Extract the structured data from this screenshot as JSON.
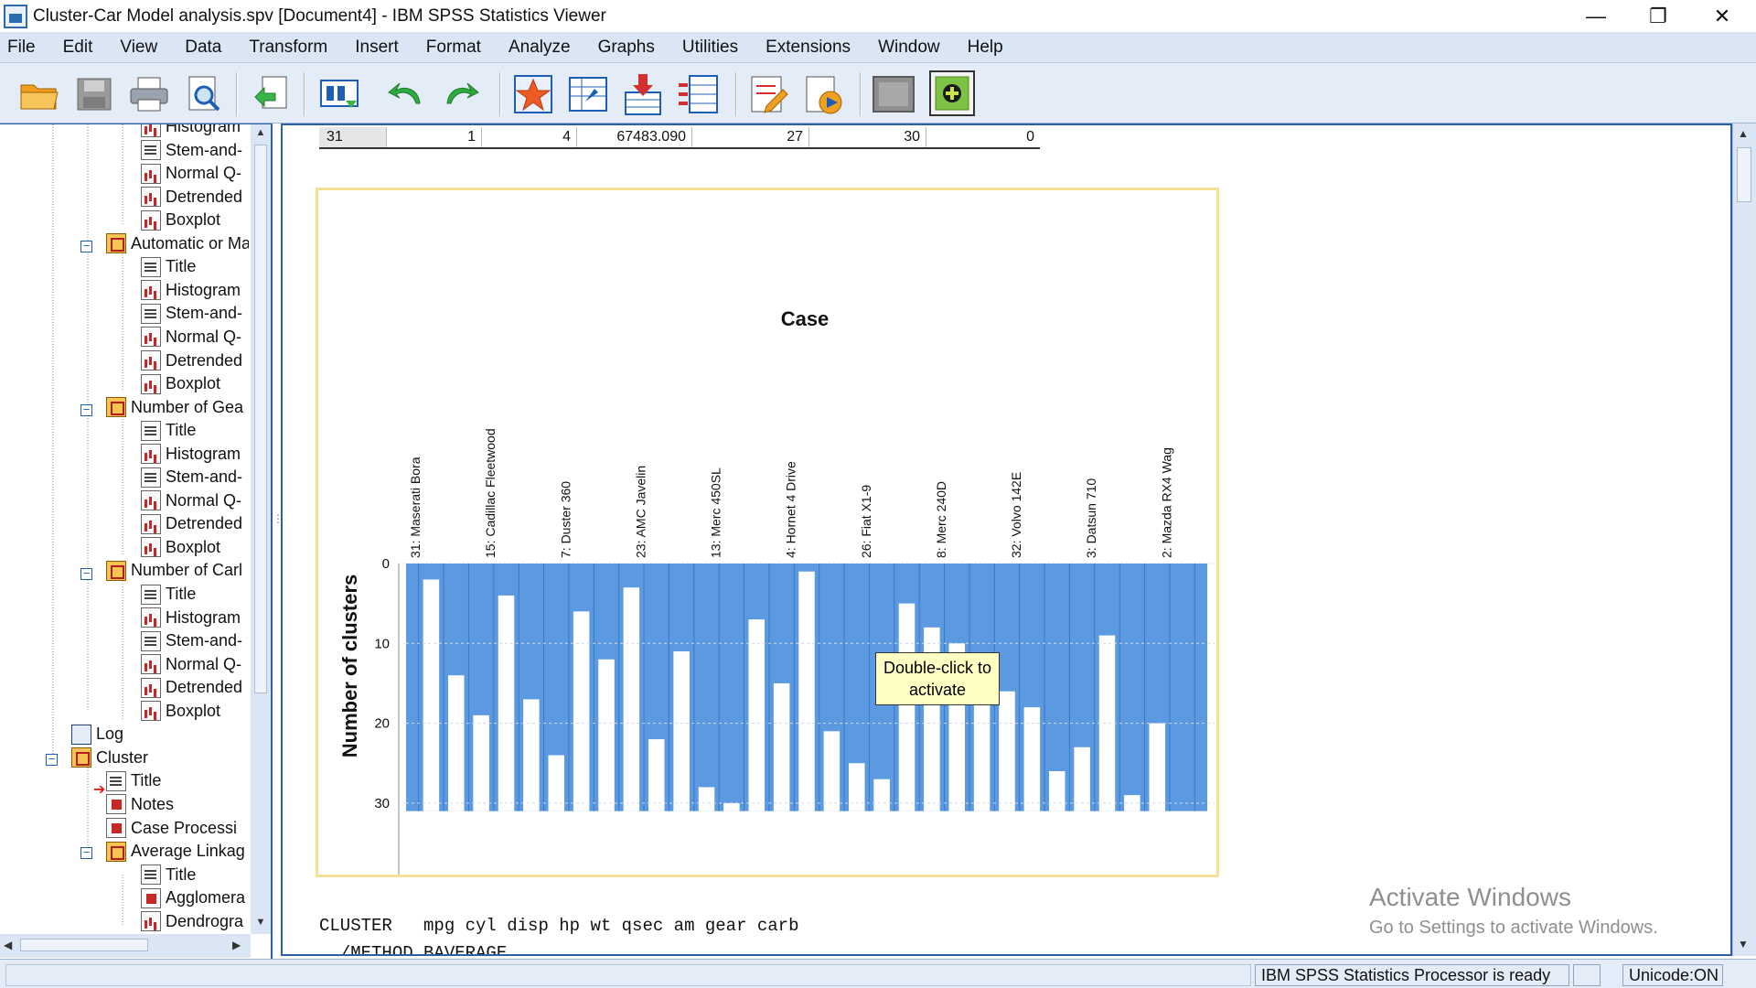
{
  "window": {
    "title": "Cluster-Car Model analysis.spv [Document4] - IBM SPSS Statistics Viewer",
    "minimize": "—",
    "restore": "❐",
    "close": "✕"
  },
  "menu": [
    "File",
    "Edit",
    "View",
    "Data",
    "Transform",
    "Insert",
    "Format",
    "Analyze",
    "Graphs",
    "Utilities",
    "Extensions",
    "Window",
    "Help"
  ],
  "toolbar": [
    "open-folder-icon",
    "save-icon",
    "print-icon",
    "print-preview-icon",
    "export-icon",
    "goto-data-icon",
    "undo-icon",
    "redo-icon",
    "designate-window-icon",
    "goto-case-icon",
    "insert-cases-icon",
    "select-variables-icon",
    "edit-output-icon",
    "run-script-icon",
    "activate-icon",
    "add-icon"
  ],
  "nav_tree": [
    {
      "label": "Histogram",
      "icon": "chart"
    },
    {
      "label": "Stem-and-",
      "icon": "text"
    },
    {
      "label": "Normal Q-",
      "icon": "chart"
    },
    {
      "label": "Detrended",
      "icon": "chart"
    },
    {
      "label": "Boxplot",
      "icon": "chart"
    },
    {
      "label": "Automatic or Ma",
      "icon": "book"
    },
    {
      "label": "Title",
      "icon": "text"
    },
    {
      "label": "Histogram",
      "icon": "chart"
    },
    {
      "label": "Stem-and-",
      "icon": "text"
    },
    {
      "label": "Normal Q-",
      "icon": "chart"
    },
    {
      "label": "Detrended",
      "icon": "chart"
    },
    {
      "label": "Boxplot",
      "icon": "chart"
    },
    {
      "label": "Number of Gea",
      "icon": "book"
    },
    {
      "label": "Title",
      "icon": "text"
    },
    {
      "label": "Histogram",
      "icon": "chart"
    },
    {
      "label": "Stem-and-",
      "icon": "text"
    },
    {
      "label": "Normal Q-",
      "icon": "chart"
    },
    {
      "label": "Detrended",
      "icon": "chart"
    },
    {
      "label": "Boxplot",
      "icon": "chart"
    },
    {
      "label": "Number of Carl",
      "icon": "book"
    },
    {
      "label": "Title",
      "icon": "text"
    },
    {
      "label": "Histogram",
      "icon": "chart"
    },
    {
      "label": "Stem-and-",
      "icon": "text"
    },
    {
      "label": "Normal Q-",
      "icon": "chart"
    },
    {
      "label": "Detrended",
      "icon": "chart"
    },
    {
      "label": "Boxplot",
      "icon": "chart"
    },
    {
      "label": "Log",
      "icon": "log"
    },
    {
      "label": "Cluster",
      "icon": "book"
    },
    {
      "label": "Title",
      "icon": "text"
    },
    {
      "label": "Notes",
      "icon": "table"
    },
    {
      "label": "Case Processi",
      "icon": "table"
    },
    {
      "label": "Average Linkag",
      "icon": "book"
    },
    {
      "label": "Title",
      "icon": "text"
    },
    {
      "label": "Agglomera",
      "icon": "table"
    },
    {
      "label": "Dendrogra",
      "icon": "chart"
    }
  ],
  "table_row": [
    "31",
    "1",
    "4",
    "67483.090",
    "27",
    "30",
    "0"
  ],
  "tooltip": "Double-click to activate",
  "syntax_line1": "CLUSTER   mpg cyl disp hp wt qsec am gear carb",
  "syntax_line2": "  /METHOD BAVERAGE",
  "watermark": {
    "line1": "Activate Windows",
    "line2": "Go to Settings to activate Windows."
  },
  "status": {
    "processor": "IBM SPSS Statistics Processor is ready",
    "unicode": "Unicode:ON"
  },
  "colors": {
    "bar": "#5b9ae0",
    "accent": "#2d5fa8"
  },
  "chart_data": {
    "type": "bar",
    "title": "Case",
    "ylabel": "Number of clusters",
    "ylim": [
      0,
      40
    ],
    "yticks": [
      0,
      10,
      20,
      30,
      40
    ],
    "y_inverted": true,
    "categories_shown": [
      "31: Maserati Bora",
      "15: Cadillac Fleetwood",
      "7: Duster 360",
      "23: AMC Javelin",
      "13: Merc 450SL",
      "4: Hornet 4 Drive",
      "26: Fiat X1-9",
      "8: Merc 240D",
      "32: Volvo 142E",
      "3: Datsun 710",
      "2: Mazda RX4 Wag"
    ],
    "icicle_gaps": [
      2,
      14,
      19,
      4,
      17,
      24,
      6,
      12,
      3,
      22,
      11,
      28,
      30,
      7,
      15,
      1,
      21,
      25,
      27,
      5,
      8,
      10,
      13,
      16,
      18,
      26,
      23,
      9,
      29,
      20,
      31
    ]
  }
}
